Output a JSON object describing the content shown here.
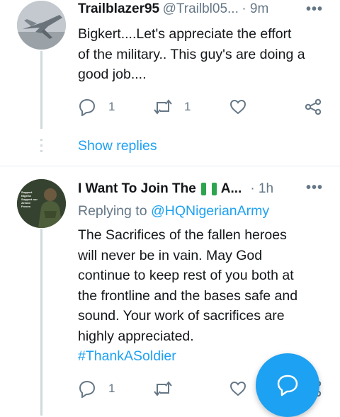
{
  "tweet1": {
    "name": "Trailblazer95",
    "handle": "@Trailbl05...",
    "time": "· 9m",
    "text_lines": [
      "Bigkert....Let's appreciate the effort",
      "of the military.. This guy's are doing a",
      "good job...."
    ],
    "reply_count": "1",
    "retweet_count": "1",
    "show_replies": "Show replies"
  },
  "tweet2": {
    "name": "I Want To Join The",
    "name_suffix": "A...",
    "time": "· 1h",
    "replying_prefix": "Replying to",
    "replying_handle": "@HQNigerianArmy",
    "text_lines": [
      "The Sacrifices of the fallen heroes",
      "will never be in vain. May God",
      "continue to keep rest of you both at",
      "the frontline and the bases safe and",
      "sound. Your work of sacrifices are",
      "highly appreciated."
    ],
    "hashtag": "#ThankASoldier",
    "reply_count": "1",
    "avatar_caption": "Support Nigeria Support our Armed Forces"
  },
  "colors": {
    "accent": "#1da1f2",
    "secondary_text": "#657786",
    "nigeria_green": "#008751"
  }
}
